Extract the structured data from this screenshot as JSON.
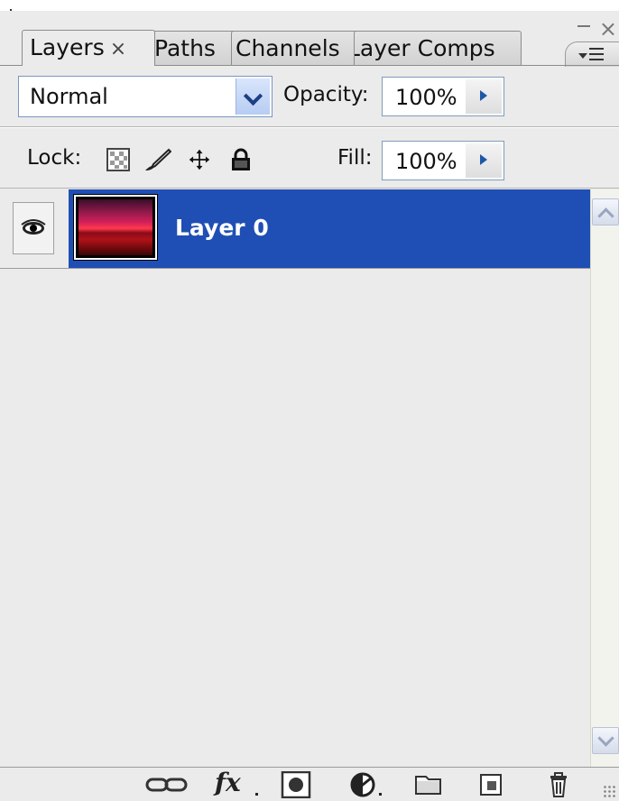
{
  "tabs": [
    {
      "label": "Layers",
      "active": true,
      "close_glyph": "×"
    },
    {
      "label": "Paths",
      "active": false
    },
    {
      "label": "Channels",
      "active": false
    },
    {
      "label": "Layer Comps",
      "active": false
    }
  ],
  "window_controls": {
    "minimize": "–",
    "close": "×"
  },
  "blend_mode": {
    "selected": "Normal"
  },
  "opacity": {
    "label": "Opacity:",
    "value": "100%"
  },
  "lock": {
    "label": "Lock:",
    "icons": [
      "lock-transparent-pixels-icon",
      "lock-image-pixels-icon",
      "lock-position-icon",
      "lock-all-icon"
    ]
  },
  "fill": {
    "label": "Fill:",
    "value": "100%"
  },
  "layers": [
    {
      "name": "Layer 0",
      "visible": true,
      "selected": true
    }
  ],
  "bottom_toolbar": {
    "fx_label": "fx",
    "icons": [
      "link-layers-icon",
      "layer-style-icon",
      "add-mask-icon",
      "adjustment-layer-icon",
      "new-group-icon",
      "new-layer-icon",
      "delete-layer-icon"
    ]
  },
  "colors": {
    "panel_bg": "#ebebeb",
    "selection": "#1f4fb4",
    "accent_arrow": "#1f57a8"
  }
}
